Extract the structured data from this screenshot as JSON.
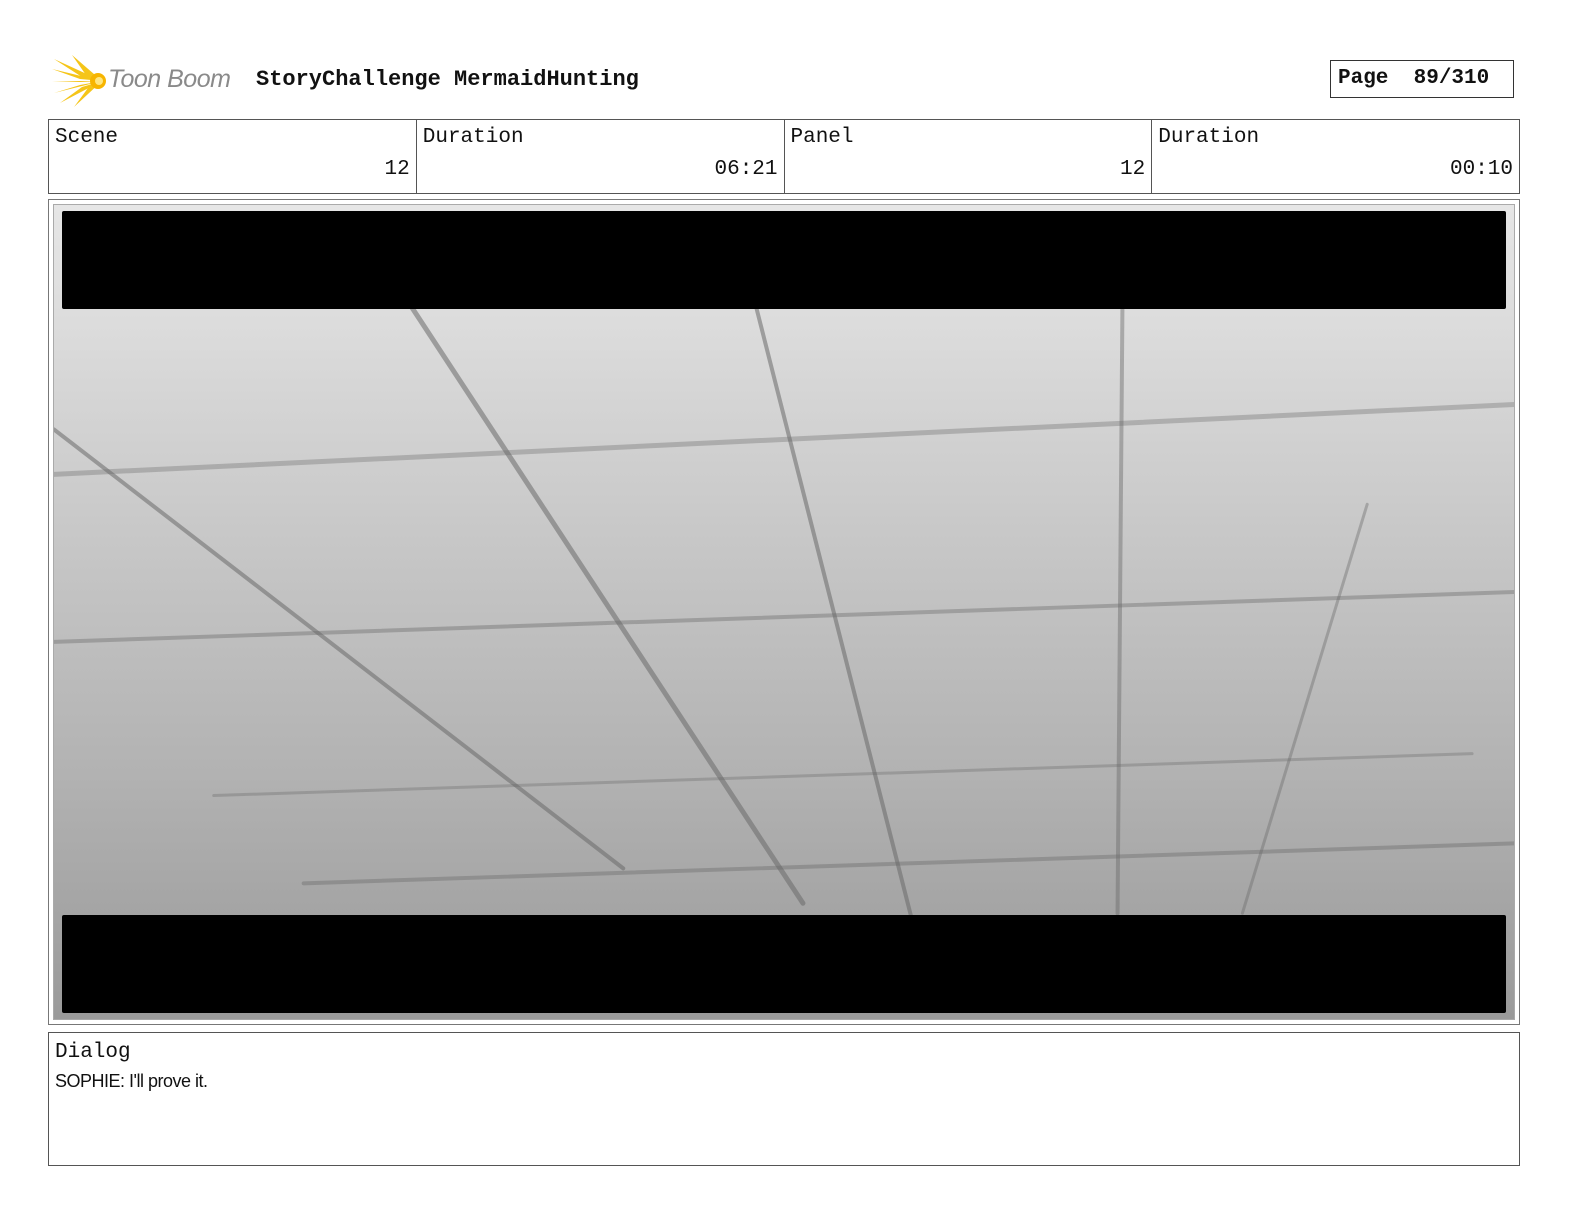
{
  "header": {
    "logo_text": "Toon Boom",
    "project_title": "StoryChallenge MermaidHunting",
    "page": "Page  89/310"
  },
  "info": {
    "scene_label": "Scene",
    "scene_value": "12",
    "scene_duration_label": "Duration",
    "scene_duration_value": "06:21",
    "panel_label": "Panel",
    "panel_value": "12",
    "panel_duration_label": "Duration",
    "panel_duration_value": "00:10"
  },
  "dialog": {
    "label": "Dialog",
    "text": "SOPHIE: I'll prove it."
  },
  "colors": {
    "logo_yellow": "#f5c518",
    "logo_gray": "#8a8a8a",
    "letterbox": "#000000"
  }
}
